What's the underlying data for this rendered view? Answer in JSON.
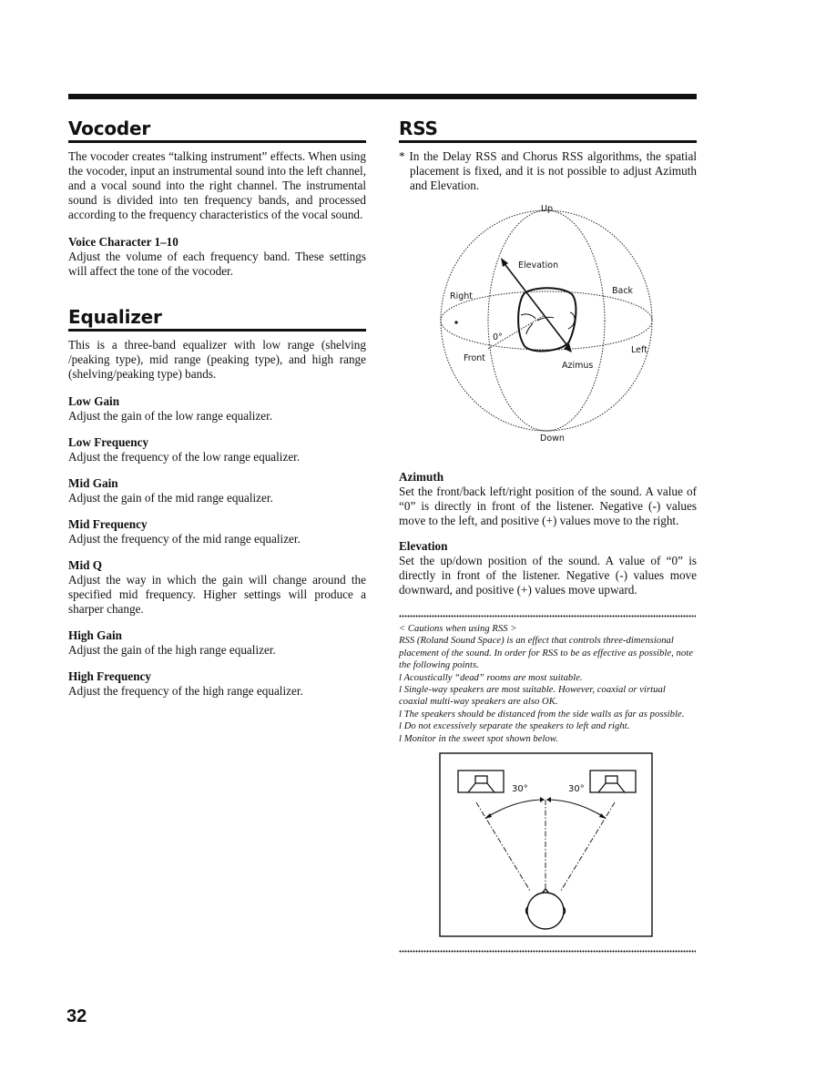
{
  "page_number": "32",
  "vocoder": {
    "title": "Vocoder",
    "description": "The vocoder creates “talking instrument” effects. When using the vocoder, input an instrumental sound into the left channel, and a vocal sound into the right channel. The instrumental sound is divided into ten frequency bands, and processed according to the frequency characteristics of the vocal sound.",
    "params": [
      {
        "name": "Voice Character 1–10",
        "text": "Adjust the volume of each frequency band. These settings will affect the tone of the vocoder."
      }
    ]
  },
  "equalizer": {
    "title": "Equalizer",
    "description": "This is a three-band equalizer with low range (shelving /peaking type), mid range (peaking type), and high range (shelving/peaking type) bands.",
    "params": [
      {
        "name": "Low Gain",
        "text": "Adjust the gain of the low range equalizer."
      },
      {
        "name": "Low Frequency",
        "text": "Adjust the frequency of the low range equalizer."
      },
      {
        "name": "Mid Gain",
        "text": "Adjust the gain of the mid range equalizer."
      },
      {
        "name": "Mid Frequency",
        "text": "Adjust the frequency of the mid range equalizer."
      },
      {
        "name": "Mid Q",
        "text": "Adjust the way in which the gain will change around the specified mid frequency. Higher settings will produce a sharper change."
      },
      {
        "name": "High Gain",
        "text": "Adjust the gain of the high range equalizer."
      },
      {
        "name": "High Frequency",
        "text": "Adjust the frequency of the high range equalizer."
      }
    ]
  },
  "rss": {
    "title": "RSS",
    "note": "* In the Delay RSS and Chorus RSS algorithms, the spatial placement is fixed, and it is not possible to adjust Azimuth and Elevation.",
    "sphere_diagram": {
      "labels": {
        "up": "Up",
        "down": "Down",
        "elevation": "Elevation",
        "right": "Right",
        "back": "Back",
        "left": "Left",
        "front": "Front",
        "zero": "0°",
        "azimuth": "Azimus"
      }
    },
    "params": [
      {
        "name": "Azimuth",
        "text": "Set the front/back left/right position of the sound. A value of “0” is directly in front of the listener. Negative (-) values move to the left, and positive (+) values move to the right."
      },
      {
        "name": "Elevation",
        "text": "Set the up/down position of the sound. A value of “0” is directly in front of the listener. Negative (-) values move downward, and positive (+) values move upward."
      }
    ],
    "cautions": {
      "heading": "< Cautions when using RSS >",
      "intro": "RSS (Roland Sound Space) is an effect that controls three-dimensional placement of the sound. In order for RSS to be as effective as possible, note the following points.",
      "points": [
        "l Acoustically “dead” rooms are most suitable.",
        "l Single-way speakers are most suitable. However, coaxial or virtual coaxial multi-way speakers are also OK.",
        "l The speakers should be distanced from the side walls as far as possible.",
        "l Do not excessively separate the speakers to left and right.",
        "l Monitor in the sweet spot shown below."
      ]
    },
    "speaker_diagram": {
      "left_angle": "30°",
      "right_angle": "30°"
    }
  }
}
